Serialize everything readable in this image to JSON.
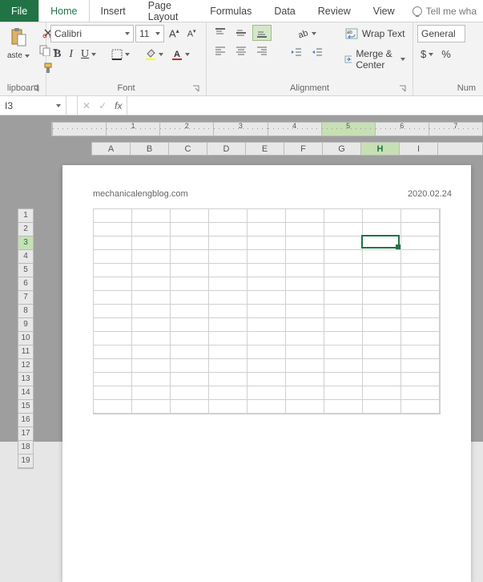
{
  "tabs": {
    "file": "File",
    "home": "Home",
    "insert": "Insert",
    "pagelayout": "Page Layout",
    "formulas": "Formulas",
    "data": "Data",
    "review": "Review",
    "view": "View",
    "tellme": "Tell me wha"
  },
  "ribbon": {
    "clipboard": {
      "label": "lipboard"
    },
    "font": {
      "label": "Font",
      "name": "Calibri",
      "size": "11",
      "bold": "B",
      "italic": "I",
      "underline": "U"
    },
    "alignment": {
      "label": "Alignment",
      "wrap": "Wrap Text",
      "merge": "Merge & Center"
    },
    "number": {
      "label": "Num",
      "format": "General",
      "currency": "$",
      "percent": "%"
    }
  },
  "formula_bar": {
    "namebox": "I3",
    "cancel": "✕",
    "enter": "✓",
    "fx": "fx",
    "value": ""
  },
  "ruler": [
    "",
    "1",
    "2",
    "3",
    "4",
    "5",
    "6",
    "7"
  ],
  "columns": [
    "A",
    "B",
    "C",
    "D",
    "E",
    "F",
    "G",
    "H",
    "I"
  ],
  "selected_column": "H",
  "rows": [
    "1",
    "2",
    "3",
    "4",
    "5",
    "6",
    "7",
    "8",
    "9",
    "10",
    "11",
    "12",
    "13",
    "14",
    "15",
    "16",
    "17",
    "18",
    "19"
  ],
  "selected_row": "3",
  "page": {
    "left_text": "mechanicalengblog.com",
    "right_text": "2020.02.24"
  },
  "grid": {
    "rows": 15,
    "cols": 9
  },
  "chart_data": null
}
